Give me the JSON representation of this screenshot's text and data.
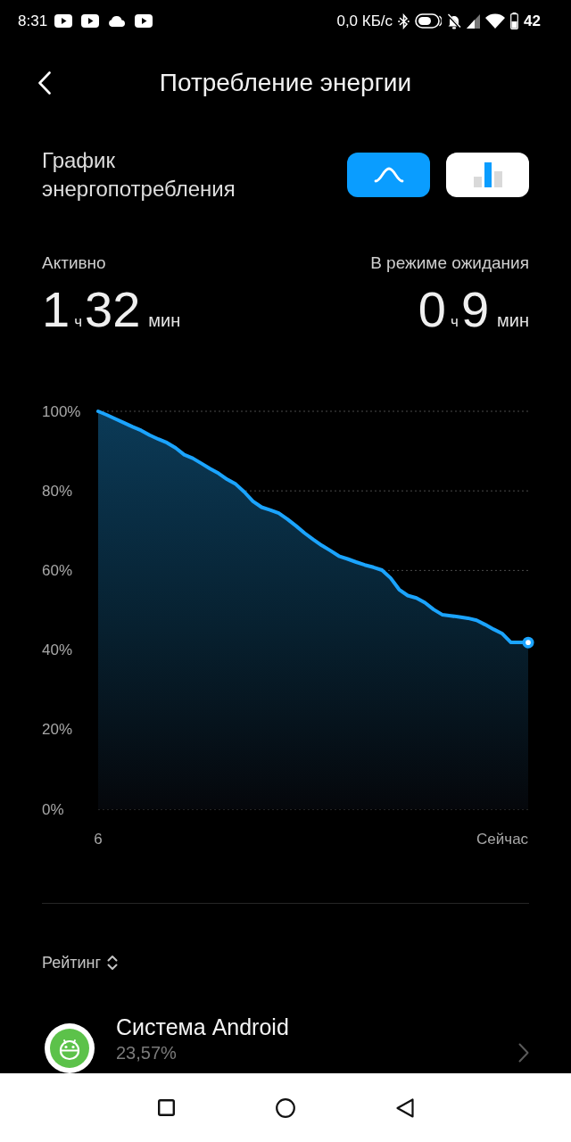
{
  "status_bar": {
    "time": "8:31",
    "network_speed": "0,0 КБ/с",
    "battery_percent": "42"
  },
  "header": {
    "title": "Потребление энергии"
  },
  "graph_section": {
    "title": "График энергопотребления",
    "view_toggles": [
      {
        "kind": "line",
        "selected": true
      },
      {
        "kind": "bar",
        "selected": false
      }
    ]
  },
  "stats": [
    {
      "label": "Активно",
      "hours": "1",
      "hours_unit": "ч",
      "minutes": "32",
      "minutes_unit": "мин"
    },
    {
      "label": "В режиме ожидания",
      "hours": "0",
      "hours_unit": "ч",
      "minutes": "9",
      "minutes_unit": "мин"
    }
  ],
  "chart_data": {
    "type": "area",
    "categories": [
      "6",
      null,
      null,
      null,
      null,
      null,
      null,
      null,
      null,
      null,
      null,
      null,
      null,
      null,
      null,
      null,
      null,
      null,
      null,
      null,
      null,
      null,
      null,
      null,
      null,
      null,
      null,
      null,
      null,
      null,
      null,
      null,
      null,
      null,
      null,
      null,
      null,
      null,
      null,
      null,
      null,
      null,
      null,
      null,
      null,
      null,
      null,
      "Сейчас",
      null,
      null,
      null
    ],
    "values": [
      100,
      99.1,
      98.1,
      97.1,
      96.1,
      95.2,
      94,
      93,
      92.1,
      90.8,
      89.1,
      88.2,
      86.9,
      85.6,
      84.4,
      82.9,
      81.7,
      79.7,
      77.4,
      75.9,
      75.2,
      74.4,
      72.9,
      71.2,
      69.4,
      67.8,
      66.3,
      65,
      63.6,
      62.9,
      62.1,
      61.4,
      60.8,
      60.1,
      58.1,
      55.2,
      53.7,
      53.1,
      51.9,
      50.2,
      48.9,
      48.6,
      48.3,
      48,
      47.5,
      46.4,
      45.2,
      44.1,
      41.9,
      41.9,
      41.9
    ],
    "ylim": [
      0,
      100
    ],
    "yticks": [
      {
        "value": 100,
        "label": "100%"
      },
      {
        "value": 80,
        "label": "80%"
      },
      {
        "value": 60,
        "label": "60%"
      },
      {
        "value": 40,
        "label": "40%"
      },
      {
        "value": 20,
        "label": "20%"
      },
      {
        "value": 0,
        "label": "0%"
      }
    ]
  },
  "ranking": {
    "label": "Рейтинг"
  },
  "apps": [
    {
      "name": "Система Android",
      "share": "23,57%"
    }
  ]
}
